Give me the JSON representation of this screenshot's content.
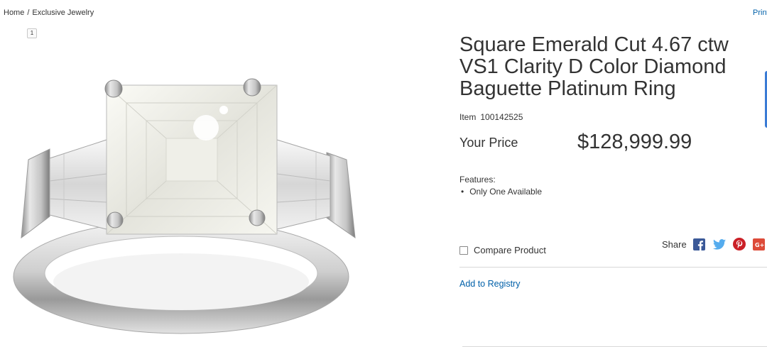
{
  "breadcrumb": {
    "items": [
      "Home",
      "Exclusive Jewelry"
    ],
    "separator": "/"
  },
  "print_link": "Print",
  "thumbnail": {
    "index": "1"
  },
  "product": {
    "title": "Square Emerald Cut 4.67 ctw VS1 Clarity D Color Diamond Baguette Platinum Ring",
    "item_label": "Item",
    "item_number": "100142525",
    "price_label": "Your Price",
    "price": "$128,999.99",
    "features_title": "Features:",
    "features": [
      "Only One Available"
    ],
    "image_alt": "ring-product-image"
  },
  "actions": {
    "compare_label": "Compare Product",
    "compare_checked": false,
    "share_label": "Share",
    "share_icons": [
      "facebook-icon",
      "twitter-icon",
      "pinterest-icon",
      "google-plus-icon"
    ],
    "registry_label": "Add to Registry"
  },
  "colors": {
    "link": "#0060a9",
    "text": "#333333",
    "facebook": "#3b5998",
    "twitter": "#55acee",
    "pinterest": "#cb2027",
    "google_plus": "#dd4b39"
  }
}
